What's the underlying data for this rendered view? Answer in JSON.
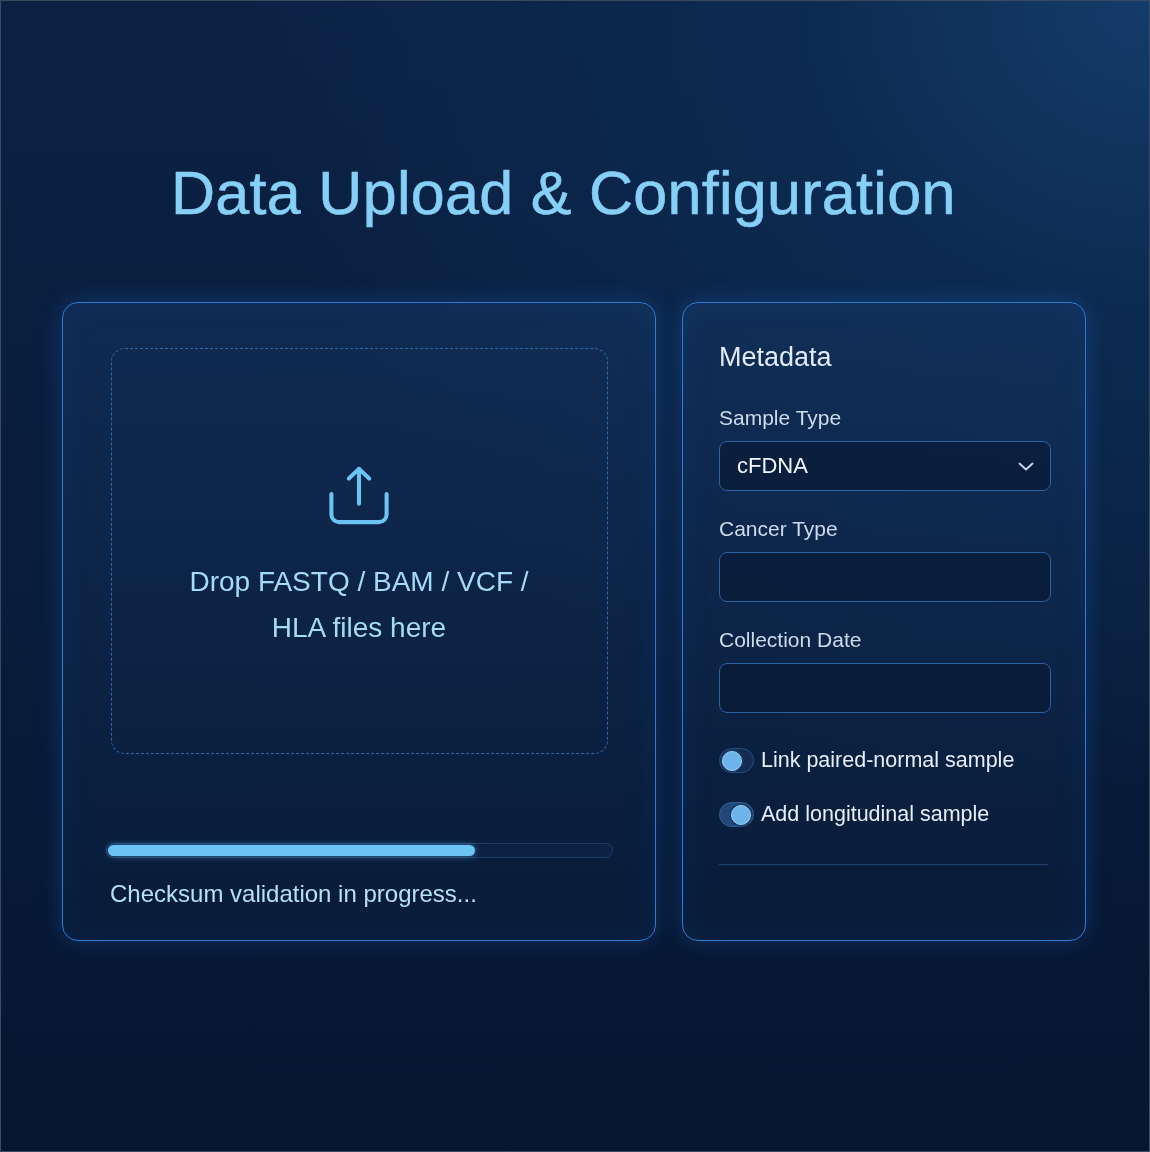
{
  "title": "Data Upload & Configuration",
  "upload": {
    "dropzone_text": "Drop FASTQ / BAM / VCF / HLA files here",
    "progress": {
      "level": 0.73
    },
    "status": "Checksum validation in progress..."
  },
  "metadata": {
    "heading": "Metadata",
    "fields": [
      {
        "kind": "select",
        "label": "Sample Type",
        "value": "cFDNA"
      },
      {
        "kind": "text",
        "label": "Cancer Type"
      },
      {
        "kind": "text",
        "label": "Collection Date"
      }
    ],
    "toggles": [
      {
        "label": "Link paired-normal sample",
        "on": false
      },
      {
        "label": "Add longitudinal sample",
        "on": true
      }
    ]
  }
}
